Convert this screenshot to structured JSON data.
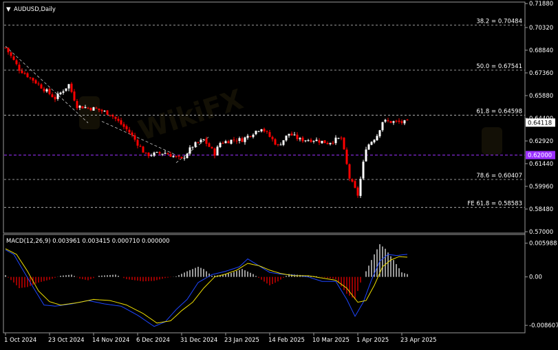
{
  "chart_data": [
    {
      "type": "candlestick",
      "title": "AUDUSD,Daily",
      "ylim": [
        0.57,
        0.718
      ],
      "ytick_labels": [
        "0.71880",
        "0.70320",
        "0.68840",
        "0.67360",
        "0.65880",
        "0.64400",
        "0.62920",
        "0.61440",
        "0.59960",
        "0.58480",
        "0.57000"
      ],
      "ytick_values": [
        0.7188,
        0.7032,
        0.6884,
        0.6736,
        0.6588,
        0.644,
        0.6292,
        0.6144,
        0.5996,
        0.5848,
        0.57
      ],
      "xtick_labels": [
        "1 Oct 2024",
        "23 Oct 2024",
        "14 Nov 2024",
        "6 Dec 2024",
        "31 Dec 2024",
        "23 Jan 2025",
        "14 Feb 2025",
        "10 Mar 2025",
        "1 Apr 2025",
        "23 Apr 2025"
      ],
      "xtick_index": [
        0,
        16,
        32,
        48,
        64,
        80,
        96,
        112,
        128,
        144
      ],
      "levels": [
        {
          "label": "38.2 = 0.70484",
          "value": 0.70484
        },
        {
          "label": "50.0 = 0.67541",
          "value": 0.67541
        },
        {
          "label": "61.8 = 0.64598",
          "value": 0.64598
        },
        {
          "label": "78.6 = 0.60407",
          "value": 0.60407
        },
        {
          "label": "FE 61.8 = 0.58583",
          "value": 0.58583
        }
      ],
      "horizontal_line": {
        "label": "0.62000",
        "value": 0.62,
        "color": "#9b30ff"
      },
      "last_price": {
        "label": "0.64118",
        "value": 0.64118
      },
      "trend_line": {
        "from": [
          0,
          0.691
        ],
        "to": [
          30,
          0.641
        ]
      },
      "trend_line2": {
        "from": [
          35,
          0.642
        ],
        "to": [
          62,
          0.62
        ]
      },
      "rise_line": {
        "from": [
          62,
          0.615
        ],
        "to": [
          74,
          0.632
        ]
      },
      "waypoints": [
        [
          0,
          0.69
        ],
        [
          5,
          0.676
        ],
        [
          10,
          0.669
        ],
        [
          18,
          0.657
        ],
        [
          23,
          0.666
        ],
        [
          26,
          0.652
        ],
        [
          33,
          0.65
        ],
        [
          38,
          0.647
        ],
        [
          45,
          0.635
        ],
        [
          51,
          0.62
        ],
        [
          58,
          0.6215
        ],
        [
          64,
          0.617
        ],
        [
          68,
          0.626
        ],
        [
          72,
          0.63
        ],
        [
          76,
          0.621
        ],
        [
          78,
          0.628
        ],
        [
          83,
          0.63
        ],
        [
          86,
          0.63
        ],
        [
          93,
          0.638
        ],
        [
          99,
          0.626
        ],
        [
          103,
          0.634
        ],
        [
          107,
          0.63
        ],
        [
          112,
          0.63
        ],
        [
          117,
          0.628
        ],
        [
          120,
          0.63
        ],
        [
          122,
          0.631
        ],
        [
          125,
          0.605
        ],
        [
          128,
          0.594
        ],
        [
          131,
          0.625
        ],
        [
          135,
          0.633
        ],
        [
          137,
          0.642
        ],
        [
          146,
          0.6412
        ]
      ],
      "colors": {
        "bull": "#ffffff",
        "bear": "#ff0000",
        "grid": "#c8c8c8",
        "trend": "#c8c8c8"
      }
    },
    {
      "type": "macd",
      "title": "MACD(12,26,9) 0.003961 0.003415 0.000710 0.000000",
      "ylim": [
        -0.0092,
        0.0068
      ],
      "ytick_labels": [
        "0.005988",
        "0.00",
        "-0.008607"
      ],
      "ytick_values": [
        0.005988,
        0.0,
        -0.008607
      ],
      "histogram_points": [
        [
          0,
          0.0003
        ],
        [
          3,
          -0.001
        ],
        [
          5,
          -0.002
        ],
        [
          8,
          -0.0018
        ],
        [
          12,
          -0.001
        ],
        [
          16,
          -0.0005
        ],
        [
          20,
          0.0002
        ],
        [
          24,
          0.0004
        ],
        [
          27,
          -0.0003
        ],
        [
          30,
          -0.0006
        ],
        [
          34,
          0.0002
        ],
        [
          40,
          0.0004
        ],
        [
          44,
          -0.0004
        ],
        [
          50,
          -0.0008
        ],
        [
          54,
          -0.0007
        ],
        [
          58,
          -0.0002
        ],
        [
          62,
          0.0001
        ],
        [
          66,
          0.001
        ],
        [
          70,
          0.0018
        ],
        [
          72,
          0.0014
        ],
        [
          75,
          0.0002
        ],
        [
          78,
          0.0003
        ],
        [
          82,
          0.0007
        ],
        [
          86,
          0.0014
        ],
        [
          90,
          0.0005
        ],
        [
          93,
          -0.0005
        ],
        [
          96,
          -0.0015
        ],
        [
          99,
          -0.0008
        ],
        [
          103,
          0.0005
        ],
        [
          108,
          0.0003
        ],
        [
          113,
          0.0001
        ],
        [
          117,
          -0.0002
        ],
        [
          120,
          -0.0004
        ],
        [
          124,
          -0.003
        ],
        [
          127,
          -0.004
        ],
        [
          129,
          -0.001
        ],
        [
          131,
          0.001
        ],
        [
          134,
          0.004
        ],
        [
          136,
          0.0058
        ],
        [
          138,
          0.005
        ],
        [
          141,
          0.003
        ],
        [
          144,
          0.0008
        ],
        [
          146,
          0.0005
        ]
      ],
      "macd_points": [
        [
          0,
          0.0048
        ],
        [
          3,
          0.004
        ],
        [
          6,
          0.0015
        ],
        [
          10,
          -0.0018
        ],
        [
          14,
          -0.005
        ],
        [
          18,
          -0.0052
        ],
        [
          24,
          -0.0048
        ],
        [
          30,
          -0.0042
        ],
        [
          36,
          -0.0048
        ],
        [
          42,
          -0.0052
        ],
        [
          48,
          -0.0068
        ],
        [
          54,
          -0.0088
        ],
        [
          58,
          -0.008
        ],
        [
          62,
          -0.0058
        ],
        [
          66,
          -0.004
        ],
        [
          70,
          -0.001
        ],
        [
          75,
          0.0004
        ],
        [
          80,
          0.001
        ],
        [
          85,
          0.0018
        ],
        [
          88,
          0.0032
        ],
        [
          92,
          0.002
        ],
        [
          96,
          0.0008
        ],
        [
          100,
          0.0005
        ],
        [
          105,
          0.0003
        ],
        [
          110,
          0.0
        ],
        [
          115,
          -0.0008
        ],
        [
          120,
          -0.0008
        ],
        [
          124,
          -0.004
        ],
        [
          127,
          -0.007
        ],
        [
          130,
          -0.0045
        ],
        [
          133,
          -0.0005
        ],
        [
          136,
          0.0028
        ],
        [
          139,
          0.004
        ],
        [
          142,
          0.0038
        ],
        [
          146,
          0.004
        ]
      ],
      "signal_points": [
        [
          0,
          0.005
        ],
        [
          4,
          0.004
        ],
        [
          8,
          0.001
        ],
        [
          12,
          -0.0025
        ],
        [
          16,
          -0.0044
        ],
        [
          20,
          -0.005
        ],
        [
          26,
          -0.0046
        ],
        [
          32,
          -0.004
        ],
        [
          38,
          -0.0042
        ],
        [
          44,
          -0.005
        ],
        [
          50,
          -0.0065
        ],
        [
          55,
          -0.0082
        ],
        [
          60,
          -0.0078
        ],
        [
          64,
          -0.006
        ],
        [
          68,
          -0.0045
        ],
        [
          72,
          -0.002
        ],
        [
          76,
          0.0
        ],
        [
          80,
          0.0005
        ],
        [
          84,
          0.0012
        ],
        [
          88,
          0.0024
        ],
        [
          92,
          0.002
        ],
        [
          96,
          0.0012
        ],
        [
          100,
          0.0006
        ],
        [
          105,
          0.0002
        ],
        [
          110,
          0.0002
        ],
        [
          115,
          -0.0002
        ],
        [
          120,
          -0.0006
        ],
        [
          124,
          -0.002
        ],
        [
          128,
          -0.0045
        ],
        [
          131,
          -0.0042
        ],
        [
          134,
          -0.0015
        ],
        [
          137,
          0.0018
        ],
        [
          140,
          0.003
        ],
        [
          143,
          0.0036
        ],
        [
          146,
          0.0035
        ]
      ],
      "colors": {
        "hist_pos": "#ffffff",
        "hist_neg": "#ff0000",
        "macd": "#1e46ff",
        "signal": "#f0e000"
      }
    }
  ]
}
